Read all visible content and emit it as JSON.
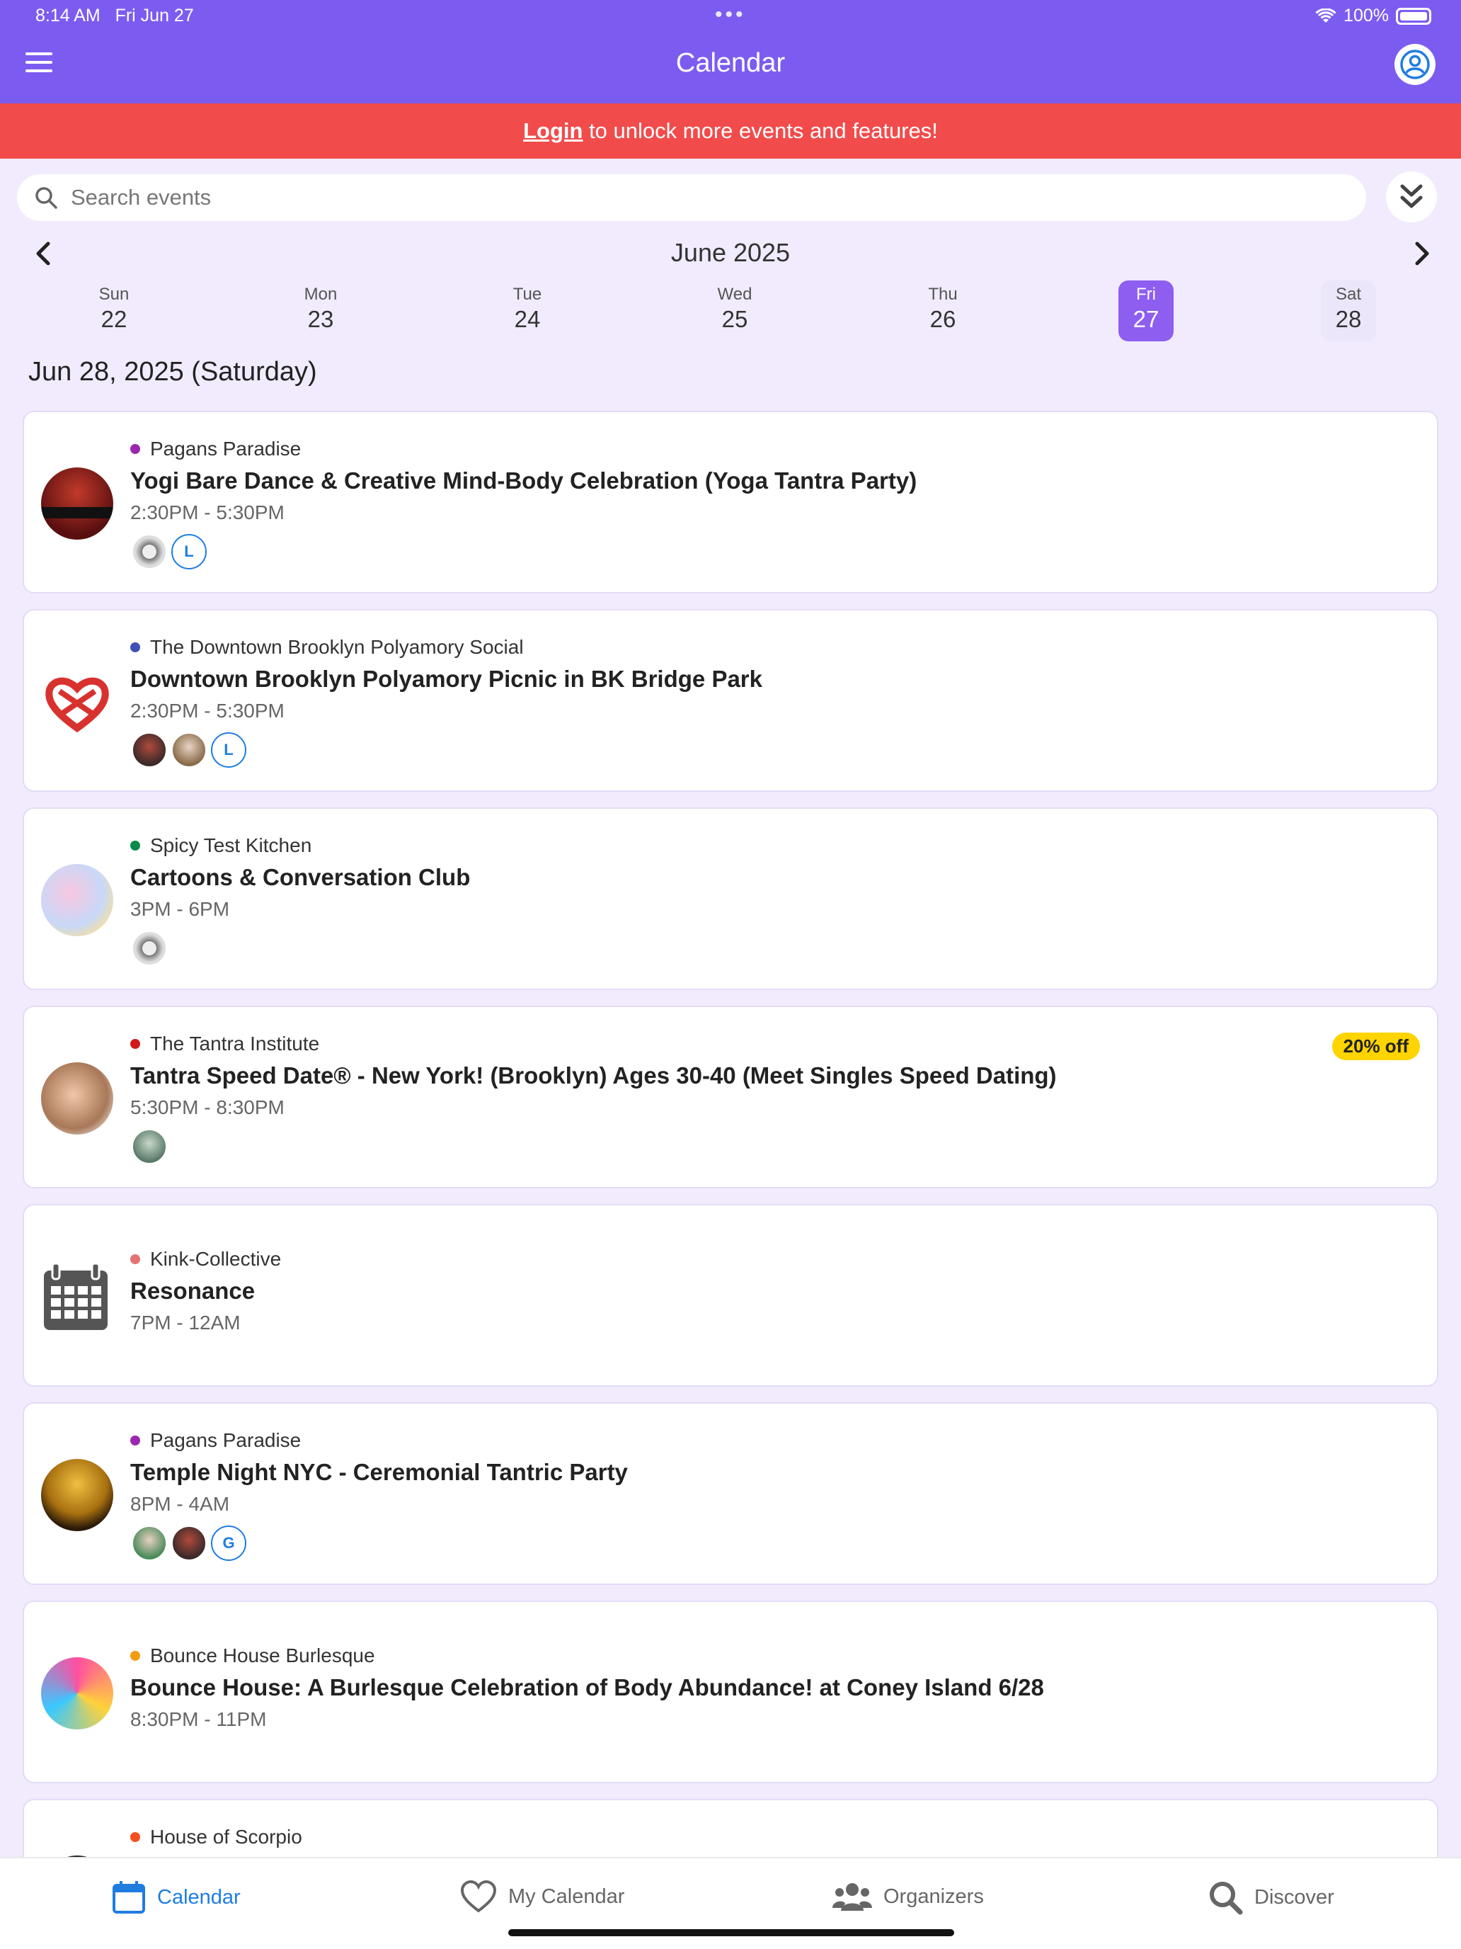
{
  "status_bar": {
    "time": "8:14 AM",
    "date": "Fri Jun 27",
    "battery": "100%"
  },
  "header": {
    "title": "Calendar"
  },
  "banner": {
    "link": "Login",
    "text": " to unlock more events and features!"
  },
  "search": {
    "placeholder": "Search events"
  },
  "calendar": {
    "month": "June 2025",
    "days": [
      {
        "name": "Sun",
        "date": "22"
      },
      {
        "name": "Mon",
        "date": "23"
      },
      {
        "name": "Tue",
        "date": "24"
      },
      {
        "name": "Wed",
        "date": "25"
      },
      {
        "name": "Thu",
        "date": "26"
      },
      {
        "name": "Fri",
        "date": "27",
        "selected": true
      },
      {
        "name": "Sat",
        "date": "28"
      }
    ],
    "heading": "Jun 28, 2025 (Saturday)"
  },
  "events": [
    {
      "organizer": "Pagans Paradise",
      "dot": "#9b27b0",
      "title": "Yogi Bare Dance & Creative Mind-Body Celebration (Yoga Tantra Party)",
      "time": "2:30PM - 5:30PM",
      "attendee_letter": "L"
    },
    {
      "organizer": "The Downtown Brooklyn Polyamory Social",
      "dot": "#3f51b5",
      "title": "Downtown Brooklyn Polyamory Picnic in BK Bridge Park",
      "time": "2:30PM - 5:30PM",
      "attendee_letter": "L"
    },
    {
      "organizer": "Spicy Test Kitchen",
      "dot": "#0b8a4a",
      "title": "Cartoons & Conversation Club",
      "time": "3PM - 6PM"
    },
    {
      "organizer": "The Tantra Institute",
      "dot": "#d11a1a",
      "title": "Tantra Speed Date® - New York! (Brooklyn) Ages 30-40 (Meet Singles Speed Dating)",
      "time": "5:30PM - 8:30PM",
      "discount": "20% off"
    },
    {
      "organizer": "Kink-Collective",
      "dot": "#e57373",
      "title": "Resonance",
      "time": "7PM - 12AM"
    },
    {
      "organizer": "Pagans Paradise",
      "dot": "#9b27b0",
      "title": "Temple Night NYC -  Ceremonial Tantric Party",
      "time": "8PM - 4AM",
      "attendee_letter": "G"
    },
    {
      "organizer": "Bounce House Burlesque",
      "dot": "#f39c12",
      "title": "Bounce House: A Burlesque Celebration of Body Abundance! at Coney Island 6/28",
      "time": "8:30PM - 11PM"
    },
    {
      "organizer": "House of Scorpio",
      "dot": "#f4511e"
    }
  ],
  "tabs": [
    {
      "label": "Calendar",
      "icon": "calendar-icon",
      "active": true
    },
    {
      "label": "My Calendar",
      "icon": "heart-icon"
    },
    {
      "label": "Organizers",
      "icon": "people-icon"
    },
    {
      "label": "Discover",
      "icon": "search-icon"
    }
  ],
  "colors": {
    "header": "#7c5cf0",
    "banner": "#f24b4b",
    "accent": "#1f7de0",
    "selected_day": "#8d5ef0",
    "discount": "#ffd400"
  }
}
